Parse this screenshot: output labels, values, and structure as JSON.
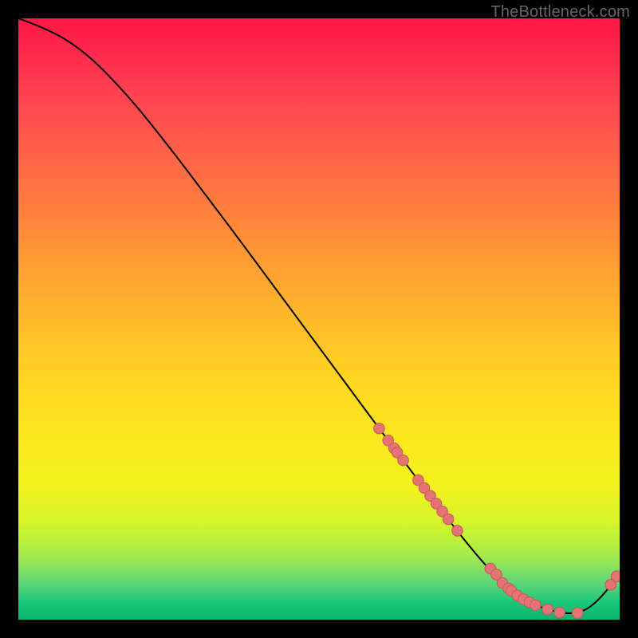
{
  "watermark": "TheBottleneck.com",
  "chart_data": {
    "type": "line",
    "title": "",
    "xlabel": "",
    "ylabel": "",
    "xlim": [
      0,
      100
    ],
    "ylim": [
      0,
      100
    ],
    "legend": false,
    "grid": false,
    "series": [
      {
        "name": "curve",
        "color": "#000000",
        "x": [
          0,
          4,
          8,
          12,
          16,
          20,
          24,
          28,
          32,
          36,
          40,
          44,
          48,
          52,
          56,
          60,
          64,
          68,
          72,
          76,
          80,
          82,
          84,
          86,
          88,
          90,
          92,
          94,
          96,
          98,
          100
        ],
        "y": [
          100,
          98.5,
          96.5,
          93.5,
          89.5,
          85,
          80,
          74.8,
          69.5,
          64.2,
          58.8,
          53.4,
          48,
          42.6,
          37.2,
          31.8,
          26.5,
          21.2,
          16,
          11,
          6.5,
          4.8,
          3.4,
          2.4,
          1.7,
          1.2,
          1.0,
          1.4,
          2.8,
          5.0,
          7.6
        ]
      }
    ],
    "markers": [
      {
        "x": 60.0,
        "y": 31.8
      },
      {
        "x": 61.5,
        "y": 29.8
      },
      {
        "x": 62.5,
        "y": 28.5
      },
      {
        "x": 63.0,
        "y": 27.8
      },
      {
        "x": 64.0,
        "y": 26.5
      },
      {
        "x": 66.5,
        "y": 23.2
      },
      {
        "x": 67.5,
        "y": 21.9
      },
      {
        "x": 68.5,
        "y": 20.6
      },
      {
        "x": 69.5,
        "y": 19.3
      },
      {
        "x": 70.5,
        "y": 18.0
      },
      {
        "x": 71.5,
        "y": 16.7
      },
      {
        "x": 73.0,
        "y": 14.8
      },
      {
        "x": 78.5,
        "y": 8.5
      },
      {
        "x": 79.5,
        "y": 7.5
      },
      {
        "x": 80.5,
        "y": 6.1
      },
      {
        "x": 81.5,
        "y": 5.2
      },
      {
        "x": 82.0,
        "y": 4.8
      },
      {
        "x": 83.0,
        "y": 4.0
      },
      {
        "x": 84.0,
        "y": 3.4
      },
      {
        "x": 85.0,
        "y": 2.9
      },
      {
        "x": 86.0,
        "y": 2.4
      },
      {
        "x": 88.0,
        "y": 1.7
      },
      {
        "x": 90.0,
        "y": 1.2
      },
      {
        "x": 93.0,
        "y": 1.1
      },
      {
        "x": 98.5,
        "y": 5.8
      },
      {
        "x": 99.5,
        "y": 7.2
      }
    ],
    "marker_style": {
      "shape": "circle",
      "fill": "#e57373",
      "stroke": "#c25b5b",
      "radius_pct": 0.9
    }
  }
}
